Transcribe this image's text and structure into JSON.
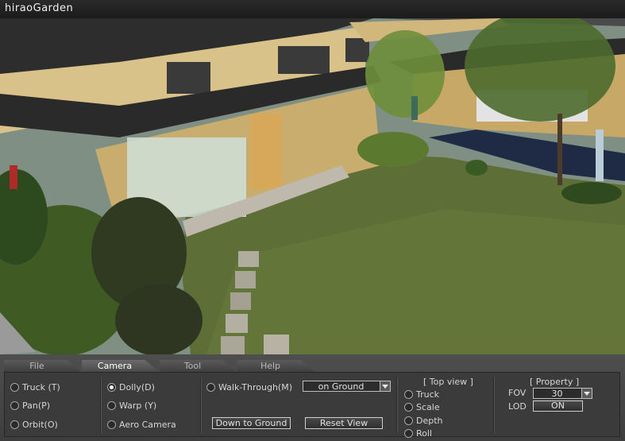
{
  "window": {
    "title": "hiraoGarden"
  },
  "tabs": [
    {
      "label": "File"
    },
    {
      "label": "Camera"
    },
    {
      "label": "Tool"
    },
    {
      "label": "Help"
    }
  ],
  "active_tab": "Camera",
  "camera": {
    "truck": "Truck (T)",
    "pan": "Pan(P)",
    "orbit": "Orbit(O)",
    "dolly": "Dolly(D)",
    "warp": "Warp (Y)",
    "aero": "Aero Camera",
    "walk": "Walk-Through(M)",
    "selected_mode": "Dolly(D)",
    "ground_select": "on Ground",
    "down_to_ground": "Down to Ground",
    "reset_view": "Reset View"
  },
  "top_view": {
    "heading": "[ Top view ]",
    "truck": "Truck",
    "scale": "Scale",
    "depth": "Depth",
    "roll": "Roll"
  },
  "property": {
    "heading": "[ Property ]",
    "fov_label": "FOV",
    "fov_value": "30",
    "lod_label": "LOD",
    "lod_value": "ON"
  },
  "colors": {
    "panel_bg": "#3b3b3b",
    "lawn": "#556b2f",
    "wall": "#d8c48a",
    "roof": "#2b2b2b"
  }
}
